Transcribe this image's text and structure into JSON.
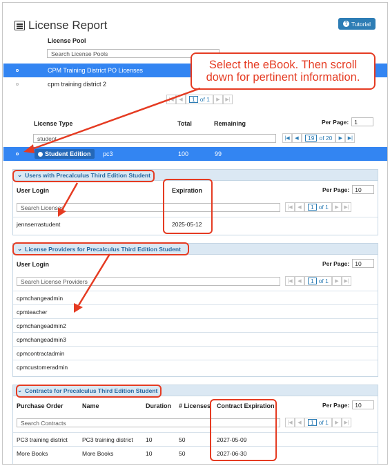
{
  "page_title": "License Report",
  "tutorial_button": "Tutorial",
  "callout_text": "Select the eBook. Then scroll down for pertinent information.",
  "license_pool": {
    "header": "License Pool",
    "search_placeholder": "Search License Pools",
    "rows": [
      "CPM Training District PO Licenses",
      "cpm training district 2"
    ],
    "pager": {
      "page": "1",
      "of": "of 1"
    }
  },
  "license_type": {
    "col_type": "License Type",
    "col_total": "Total",
    "col_remaining": "Remaining",
    "per_page_label": "Per Page:",
    "per_page_value": "1",
    "search_value": "student",
    "pager": {
      "page": "19",
      "of": "of 20"
    },
    "row": {
      "badge": "Student Edition",
      "name": "pc3",
      "total": "100",
      "remaining": "99"
    }
  },
  "users_section": {
    "title": "Users with Precalculus Third Edition Student",
    "col_login": "User Login",
    "col_expiration": "Expiration",
    "per_page_label": "Per Page:",
    "per_page_value": "10",
    "search_placeholder": "Search Licenses",
    "pager": {
      "page": "1",
      "of": "of 1"
    },
    "rows": [
      {
        "login": "jennserrastudent",
        "expiration": "2025-05-12"
      }
    ]
  },
  "providers_section": {
    "title": "License Providers for Precalculus Third Edition Student",
    "col_login": "User Login",
    "per_page_label": "Per Page:",
    "per_page_value": "10",
    "search_placeholder": "Search License Providers",
    "pager": {
      "page": "1",
      "of": "of 1"
    },
    "rows": [
      "cpmchangeadmin",
      "cpmteacher",
      "cpmchangeadmin2",
      "cpmchangeadmin3",
      "cpmcontractadmin",
      "cpmcustomeradmin"
    ]
  },
  "contracts_section": {
    "title": "Contracts for Precalculus Third Edition Student",
    "col_po": "Purchase Order",
    "col_name": "Name",
    "col_duration": "Duration",
    "col_licenses": "# Licenses",
    "col_expiration": "Contract Expiration",
    "per_page_label": "Per Page:",
    "per_page_value": "10",
    "search_placeholder": "Search Contracts",
    "pager": {
      "page": "1",
      "of": "of 1"
    },
    "rows": [
      {
        "po": "PC3 training district",
        "name": "PC3 training district",
        "duration": "10",
        "licenses": "50",
        "expiration": "2027-05-09"
      },
      {
        "po": "More Books",
        "name": "More Books",
        "duration": "10",
        "licenses": "50",
        "expiration": "2027-06-30"
      }
    ]
  }
}
